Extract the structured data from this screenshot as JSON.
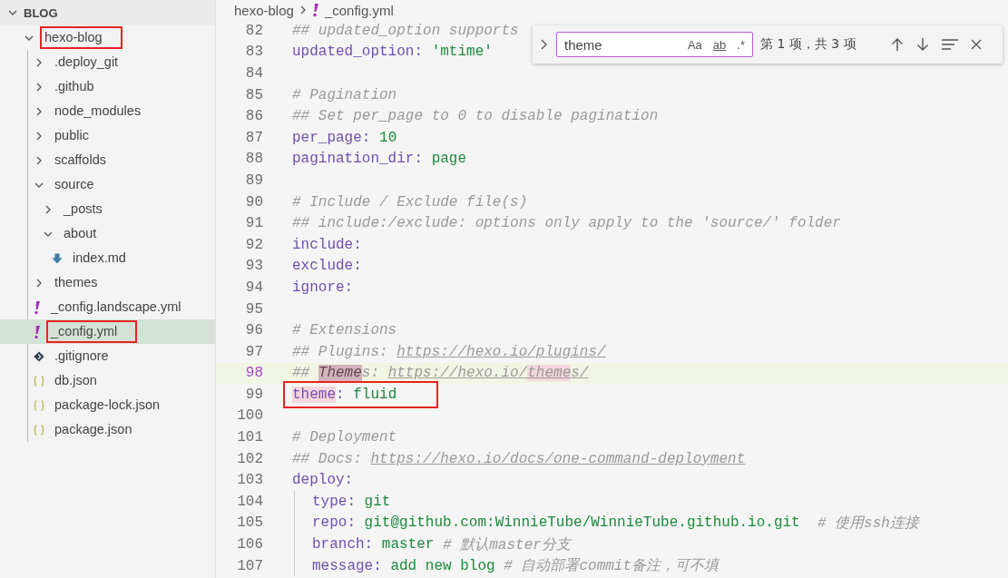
{
  "explorer": {
    "title": "BLOG",
    "expanded": true,
    "tree": [
      {
        "label": "hexo-blog",
        "kind": "folder",
        "expanded": true,
        "selected": false,
        "annotated": true,
        "children": [
          {
            "label": ".deploy_git",
            "kind": "folder",
            "expanded": false,
            "selected": false,
            "annotated": false
          },
          {
            "label": ".github",
            "kind": "folder",
            "expanded": false,
            "selected": false,
            "annotated": false
          },
          {
            "label": "node_modules",
            "kind": "folder",
            "expanded": false,
            "selected": false,
            "annotated": false
          },
          {
            "label": "public",
            "kind": "folder",
            "expanded": false,
            "selected": false,
            "annotated": false
          },
          {
            "label": "scaffolds",
            "kind": "folder",
            "expanded": false,
            "selected": false,
            "annotated": false
          },
          {
            "label": "source",
            "kind": "folder",
            "expanded": true,
            "selected": false,
            "annotated": false,
            "children": [
              {
                "label": "_posts",
                "kind": "folder",
                "expanded": false,
                "selected": false,
                "annotated": false
              },
              {
                "label": "about",
                "kind": "folder",
                "expanded": true,
                "selected": false,
                "annotated": false,
                "children": [
                  {
                    "label": "index.md",
                    "kind": "markdown",
                    "selected": false,
                    "annotated": false
                  }
                ]
              }
            ]
          },
          {
            "label": "themes",
            "kind": "folder",
            "expanded": false,
            "selected": false,
            "annotated": false
          },
          {
            "label": "_config.landscape.yml",
            "kind": "yaml",
            "selected": false,
            "annotated": false
          },
          {
            "label": "_config.yml",
            "kind": "yaml",
            "selected": true,
            "annotated": true
          },
          {
            "label": ".gitignore",
            "kind": "git",
            "selected": false,
            "annotated": false
          },
          {
            "label": "db.json",
            "kind": "json",
            "selected": false,
            "annotated": false
          },
          {
            "label": "package-lock.json",
            "kind": "json",
            "selected": false,
            "annotated": false
          },
          {
            "label": "package.json",
            "kind": "json",
            "selected": false,
            "annotated": false
          }
        ]
      }
    ]
  },
  "breadcrumb": [
    {
      "label": "hexo-blog",
      "kind": "folder"
    },
    {
      "label": "_config.yml",
      "kind": "yaml"
    }
  ],
  "find": {
    "value": "theme",
    "options": [
      "Aa",
      "ab",
      ".*"
    ],
    "result": "第 1 项，共 3 项"
  },
  "lines": [
    {
      "n": "82",
      "current": false,
      "annotated": false,
      "tokens": [
        {
          "kind": "comment",
          "text": "## updated_option supports"
        }
      ]
    },
    {
      "n": "83",
      "current": false,
      "annotated": false,
      "tokens": [
        {
          "kind": "key",
          "text": "updated_option:"
        },
        {
          "kind": "value",
          "text": " 'mtime'"
        }
      ]
    },
    {
      "n": "84",
      "current": false,
      "annotated": false
    },
    {
      "n": "85",
      "current": false,
      "annotated": false,
      "tokens": [
        {
          "kind": "comment",
          "text": "# Pagination"
        }
      ]
    },
    {
      "n": "86",
      "current": false,
      "annotated": false,
      "tokens": [
        {
          "kind": "comment",
          "text": "## Set per_page to 0 to disable pagination"
        }
      ]
    },
    {
      "n": "87",
      "current": false,
      "annotated": false,
      "tokens": [
        {
          "kind": "key",
          "text": "per_page:"
        },
        {
          "kind": "value",
          "text": " 10"
        }
      ]
    },
    {
      "n": "88",
      "current": false,
      "annotated": false,
      "tokens": [
        {
          "kind": "key",
          "text": "pagination_dir:"
        },
        {
          "kind": "value",
          "text": " page"
        }
      ]
    },
    {
      "n": "89",
      "current": false,
      "annotated": false
    },
    {
      "n": "90",
      "current": false,
      "annotated": false,
      "tokens": [
        {
          "kind": "comment",
          "text": "# Include / Exclude file(s)"
        }
      ]
    },
    {
      "n": "91",
      "current": false,
      "annotated": false,
      "tokens": [
        {
          "kind": "comment",
          "text": "## include:/exclude: options only apply to the 'source/' folder"
        }
      ]
    },
    {
      "n": "92",
      "current": false,
      "annotated": false,
      "tokens": [
        {
          "kind": "key",
          "text": "include:"
        }
      ]
    },
    {
      "n": "93",
      "current": false,
      "annotated": false,
      "tokens": [
        {
          "kind": "key",
          "text": "exclude:"
        }
      ]
    },
    {
      "n": "94",
      "current": false,
      "annotated": false,
      "tokens": [
        {
          "kind": "key",
          "text": "ignore:"
        }
      ]
    },
    {
      "n": "95",
      "current": false,
      "annotated": false
    },
    {
      "n": "96",
      "current": false,
      "annotated": false,
      "tokens": [
        {
          "kind": "comment",
          "text": "# Extensions"
        }
      ]
    },
    {
      "n": "97",
      "current": false,
      "annotated": false,
      "tokens": [
        {
          "kind": "comment",
          "text": "## Plugins: "
        },
        {
          "kind": "link",
          "text": "https://hexo.io/plugins/"
        }
      ]
    },
    {
      "n": "98",
      "current": true,
      "annotated": false,
      "tokens": [
        {
          "kind": "comment",
          "text": "## "
        },
        {
          "kind": "comment",
          "text": "Theme",
          "match": true,
          "active": true
        },
        {
          "kind": "comment",
          "text": "s: "
        },
        {
          "kind": "link",
          "text": "https://hexo.io/"
        },
        {
          "kind": "link",
          "text": "theme",
          "match": true,
          "active": false
        },
        {
          "kind": "link",
          "text": "s/"
        }
      ]
    },
    {
      "n": "99",
      "current": false,
      "annotated": true,
      "tokens": [
        {
          "kind": "key",
          "text": "theme",
          "match": true,
          "active": false
        },
        {
          "kind": "key",
          "text": ":"
        },
        {
          "kind": "value",
          "text": " fluid"
        }
      ]
    },
    {
      "n": "100",
      "current": false,
      "annotated": false
    },
    {
      "n": "101",
      "current": false,
      "annotated": false,
      "tokens": [
        {
          "kind": "comment",
          "text": "# Deployment"
        }
      ]
    },
    {
      "n": "102",
      "current": false,
      "annotated": false,
      "tokens": [
        {
          "kind": "comment",
          "text": "## Docs: "
        },
        {
          "kind": "link",
          "text": "https://hexo.io/docs/one-command-deployment"
        }
      ]
    },
    {
      "n": "103",
      "current": false,
      "annotated": false,
      "tokens": [
        {
          "kind": "key",
          "text": "deploy:"
        }
      ],
      "children": [
        {
          "n": "104",
          "current": false,
          "annotated": false,
          "tokens": [
            {
              "kind": "key",
              "text": "type:"
            },
            {
              "kind": "value",
              "text": " git"
            }
          ]
        },
        {
          "n": "105",
          "current": false,
          "annotated": false,
          "tokens": [
            {
              "kind": "key",
              "text": "repo:"
            },
            {
              "kind": "value",
              "text": " git@github.com:WinnieTube/WinnieTube.github.io.git"
            },
            {
              "kind": "comment",
              "text": "  # 使用ssh连接"
            }
          ]
        },
        {
          "n": "106",
          "current": false,
          "annotated": false,
          "tokens": [
            {
              "kind": "key",
              "text": "branch:"
            },
            {
              "kind": "value",
              "text": " master"
            },
            {
              "kind": "comment",
              "text": " # 默认master分支"
            }
          ]
        },
        {
          "n": "107",
          "current": false,
          "annotated": false,
          "tokens": [
            {
              "kind": "key",
              "text": "message:"
            },
            {
              "kind": "value",
              "text": " add new blog"
            },
            {
              "kind": "comment",
              "text": " # 自动部署commit备注，可不填"
            }
          ]
        }
      ]
    }
  ]
}
